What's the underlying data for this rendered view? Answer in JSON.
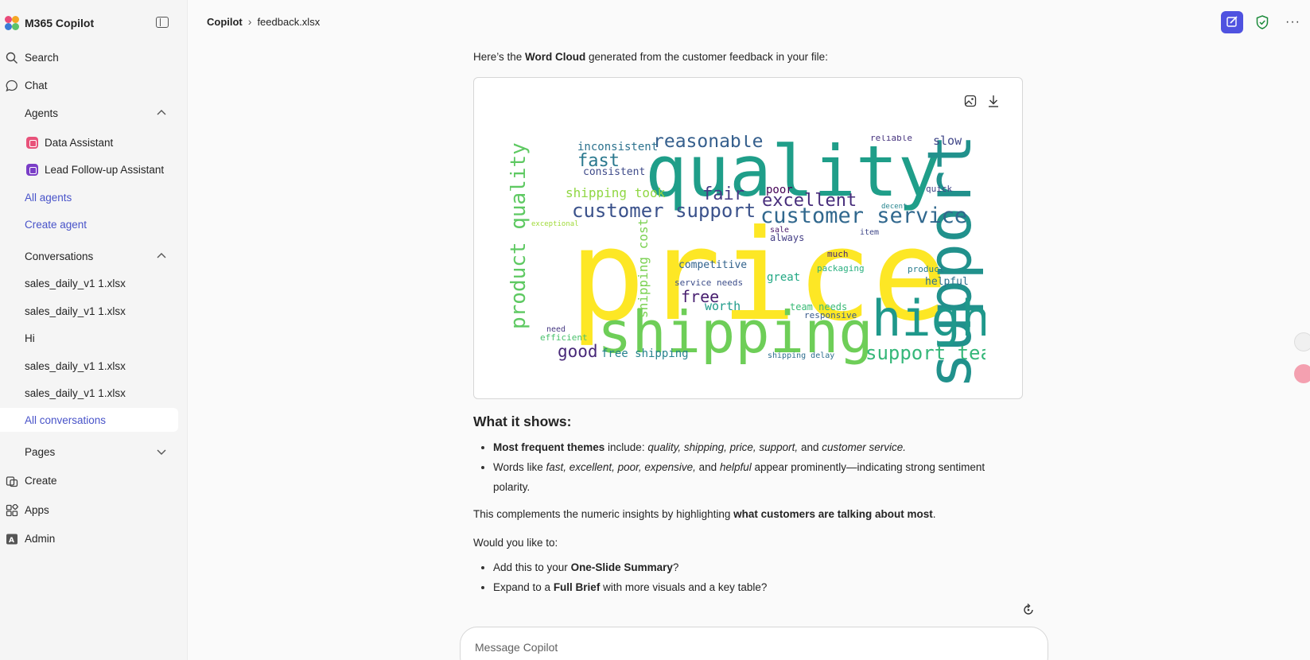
{
  "sidebar": {
    "app_title": "M365 Copilot",
    "search_label": "Search",
    "chat_label": "Chat",
    "agents_header": "Agents",
    "agents": [
      {
        "label": "Data Assistant",
        "color": "#e8527a"
      },
      {
        "label": "Lead Follow-up Assistant",
        "color": "#7a3ec7"
      }
    ],
    "all_agents": "All agents",
    "create_agent": "Create agent",
    "conversations_header": "Conversations",
    "conversations": [
      "sales_daily_v1 1.xlsx",
      "sales_daily_v1 1.xlsx",
      "Hi",
      "sales_daily_v1 1.xlsx",
      "sales_daily_v1 1.xlsx"
    ],
    "all_conversations": "All conversations",
    "pages_label": "Pages",
    "create_label": "Create",
    "apps_label": "Apps",
    "admin_label": "Admin"
  },
  "header": {
    "root": "Copilot",
    "file": "feedback.xlsx"
  },
  "message": {
    "intro_prefix": "Here’s the ",
    "intro_bold": "Word Cloud",
    "intro_suffix": " generated from the customer feedback in your file:",
    "shows_heading": "What it shows:",
    "bullet1_bold": "Most frequent themes",
    "bullet1_mid": " include: ",
    "bullet1_terms": "quality, shipping, price, support,",
    "bullet1_and": " and ",
    "bullet1_last": "customer service.",
    "bullet2_prefix": "Words like ",
    "bullet2_terms": "fast, excellent, poor, expensive,",
    "bullet2_and": " and ",
    "bullet2_last": "helpful",
    "bullet2_suffix": " appear prominently—indicating strong sentiment polarity.",
    "complement_prefix": "This complements the numeric insights by highlighting ",
    "complement_bold": "what customers are talking about most",
    "complement_suffix": ".",
    "question": "Would you like to:",
    "opt1_prefix": "Add this to your ",
    "opt1_bold": "One-Slide Summary",
    "opt1_suffix": "?",
    "opt2_prefix": "Expand to a ",
    "opt2_bold": "Full Brief",
    "opt2_suffix": " with more visuals and a key table?"
  },
  "composer": {
    "placeholder": "Message Copilot"
  },
  "wordcloud": {
    "words": [
      {
        "t": "price",
        "c": "#fde725"
      },
      {
        "t": "quality",
        "c": "#1f9e89"
      },
      {
        "t": "shipping",
        "c": "#6ece58"
      },
      {
        "t": "support",
        "c": "#21918c"
      },
      {
        "t": "high",
        "c": "#1f988b"
      },
      {
        "t": "customer support",
        "c": "#3b528b"
      },
      {
        "t": "customer service",
        "c": "#31688e"
      },
      {
        "t": "product quality",
        "c": "#5ec962"
      },
      {
        "t": "reasonable",
        "c": "#355f8d"
      },
      {
        "t": "support team",
        "c": "#35b779"
      },
      {
        "t": "excellent",
        "c": "#472d7b"
      },
      {
        "t": "fast",
        "c": "#2a788e"
      },
      {
        "t": "fair",
        "c": "#443983"
      },
      {
        "t": "shipping took",
        "c": "#90d743"
      },
      {
        "t": "shipping cost",
        "c": "#7ad151"
      },
      {
        "t": "good",
        "c": "#482878"
      },
      {
        "t": "free",
        "c": "#481f70"
      },
      {
        "t": "inconsistent",
        "c": "#2c728e"
      },
      {
        "t": "consistent",
        "c": "#3e4a89"
      },
      {
        "t": "slow",
        "c": "#404688"
      },
      {
        "t": "poor",
        "c": "#440154"
      },
      {
        "t": "reliable",
        "c": "#46337e"
      },
      {
        "t": "free shipping",
        "c": "#26828e"
      },
      {
        "t": "worth",
        "c": "#1e9b8a"
      },
      {
        "t": "competitive",
        "c": "#33638d"
      },
      {
        "t": "great",
        "c": "#22a884"
      },
      {
        "t": "helpful",
        "c": "#2d708e"
      },
      {
        "t": "product",
        "c": "#287c8e"
      },
      {
        "t": "team needs",
        "c": "#3aba76"
      },
      {
        "t": "always",
        "c": "#433e85"
      },
      {
        "t": "efficient",
        "c": "#4ac16d"
      },
      {
        "t": "responsive",
        "c": "#38598c"
      },
      {
        "t": "quick",
        "c": "#414487"
      },
      {
        "t": "much",
        "c": "#482677"
      },
      {
        "t": "service needs",
        "c": "#3d4e8a"
      },
      {
        "t": "packaging",
        "c": "#2ab07f"
      },
      {
        "t": "need",
        "c": "#453781"
      },
      {
        "t": "shipping delay",
        "c": "#2e6e8e"
      },
      {
        "t": "exceptional",
        "c": "#a0da39"
      },
      {
        "t": "item",
        "c": "#3f4788"
      },
      {
        "t": "decent",
        "c": "#25848e"
      },
      {
        "t": "sale",
        "c": "#481769"
      }
    ]
  }
}
